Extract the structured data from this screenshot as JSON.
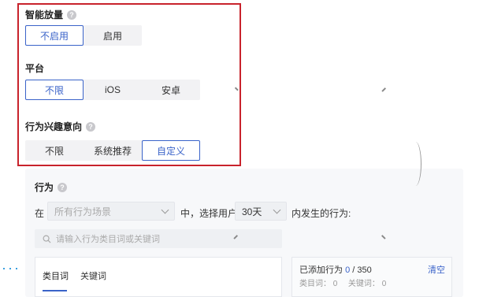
{
  "smart_volume": {
    "label": "智能放量",
    "help_icon": "question-circle-icon",
    "options": [
      "不启用",
      "启用"
    ],
    "selected": "不启用"
  },
  "platform": {
    "label": "平台",
    "options": [
      "不限",
      "iOS",
      "安卓"
    ],
    "selected": "不限"
  },
  "behavior_interest": {
    "label": "行为兴趣意向",
    "help_icon": "question-circle-icon",
    "options": [
      "不限",
      "系统推荐",
      "自定义"
    ],
    "selected": "自定义"
  },
  "behavior": {
    "label": "行为",
    "help_icon": "question-circle-icon",
    "prefix_text": "在",
    "scene_select": {
      "placeholder": "所有行为场景"
    },
    "middle_text": "中，选择用户",
    "days_select": {
      "value": "30天"
    },
    "suffix_text": "内发生的行为:",
    "search": {
      "placeholder": "请输入行为类目词或关键词",
      "icon": "search-icon"
    },
    "tabs": [
      "类目词",
      "关键词"
    ],
    "active_tab": "类目词",
    "added": {
      "label": "已添加行为",
      "count": "0",
      "separator": "/",
      "max": "350",
      "clear_label": "清空",
      "category_label": "类目词：",
      "category_count": "0",
      "keyword_label": "关键词：",
      "keyword_count": "0"
    }
  },
  "colors": {
    "accent": "#3a63c9",
    "highlight_border": "#c8232c"
  }
}
